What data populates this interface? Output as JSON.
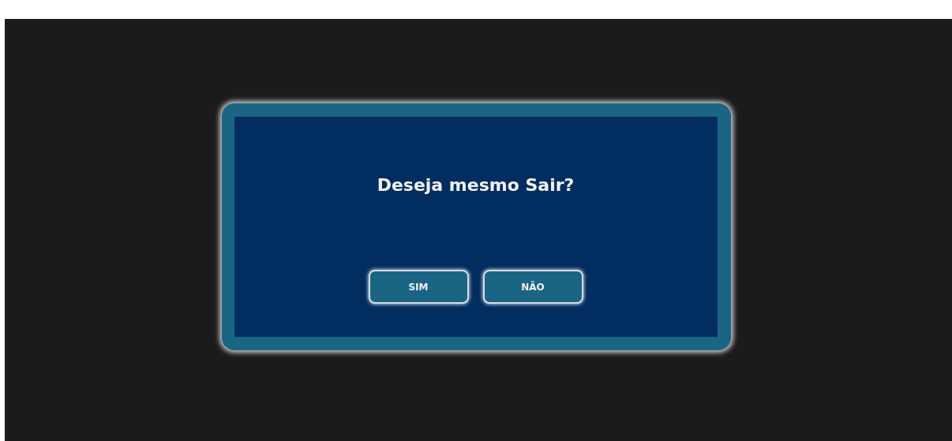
{
  "dialog": {
    "message": "Deseja mesmo Sair?",
    "buttons": [
      {
        "label": "SIM"
      },
      {
        "label": "NÃO"
      }
    ]
  }
}
